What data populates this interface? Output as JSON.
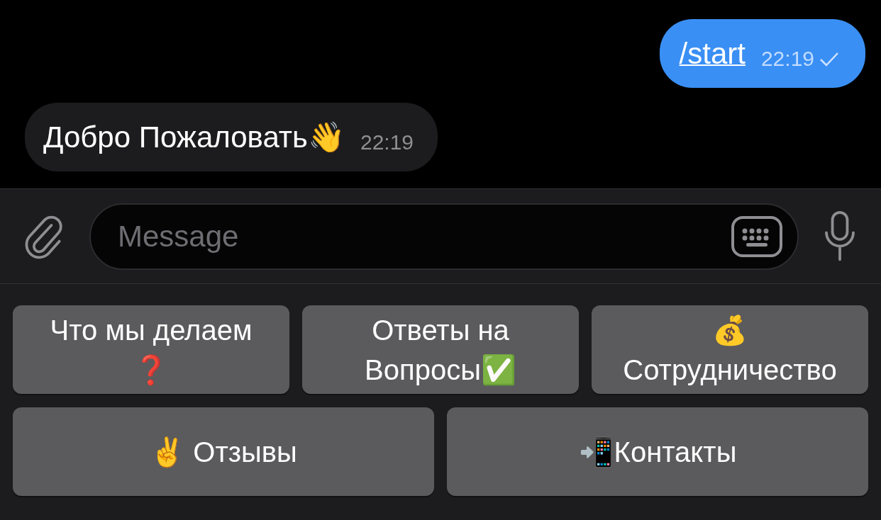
{
  "messages": [
    {
      "outgoing": true,
      "kind": "command",
      "text": "/start",
      "time": "22:19",
      "read": false
    },
    {
      "outgoing": false,
      "kind": "text",
      "text": "Добро Пожаловать👋",
      "time": "22:19"
    }
  ],
  "composer": {
    "placeholder": "Message"
  },
  "keyboard": [
    [
      {
        "label": "Что мы делаем\n❓"
      },
      {
        "label": "Ответы на\nВопросы✅"
      },
      {
        "label": "💰\nСотрудничество"
      }
    ],
    [
      {
        "label": "✌️ Отзывы"
      },
      {
        "label": "📲Контакты"
      }
    ]
  ]
}
